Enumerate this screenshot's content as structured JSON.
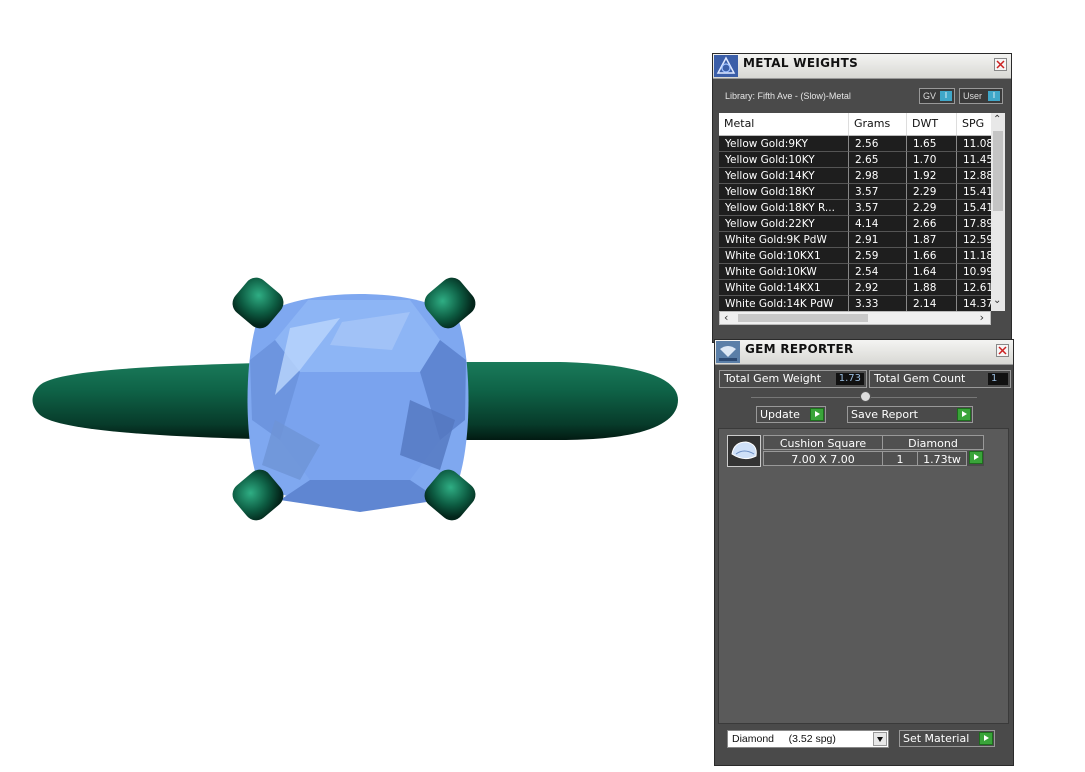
{
  "metal_weights": {
    "title": "METAL WEIGHTS",
    "library": "Library: Fifth Ave - (Slow)-Metal",
    "toggle_gv": "GV",
    "toggle_user": "User",
    "toggle_indicator": "I",
    "columns": [
      "Metal",
      "Grams",
      "DWT",
      "SPG"
    ],
    "rows": [
      [
        "Yellow Gold:9KY",
        "2.56",
        "1.65",
        "11.08"
      ],
      [
        "Yellow Gold:10KY",
        "2.65",
        "1.70",
        "11.45"
      ],
      [
        "Yellow Gold:14KY",
        "2.98",
        "1.92",
        "12.88"
      ],
      [
        "Yellow Gold:18KY",
        "3.57",
        "2.29",
        "15.41"
      ],
      [
        "Yellow Gold:18KY R...",
        "3.57",
        "2.29",
        "15.41"
      ],
      [
        "Yellow Gold:22KY",
        "4.14",
        "2.66",
        "17.89"
      ],
      [
        "White Gold:9K PdW",
        "2.91",
        "1.87",
        "12.59"
      ],
      [
        "White Gold:10KX1",
        "2.59",
        "1.66",
        "11.18"
      ],
      [
        "White Gold:10KW",
        "2.54",
        "1.64",
        "10.99"
      ],
      [
        "White Gold:14KX1",
        "2.92",
        "1.88",
        "12.61"
      ],
      [
        "White Gold:14K PdW",
        "3.33",
        "2.14",
        "14.37"
      ]
    ]
  },
  "gem_reporter": {
    "title": "GEM REPORTER",
    "total_weight_label": "Total Gem Weight",
    "total_weight_value": "1.73",
    "total_count_label": "Total Gem Count",
    "total_count_value": "1",
    "update_label": "Update",
    "save_report_label": "Save Report",
    "gem": {
      "shape": "Cushion Square",
      "material": "Diamond",
      "size": "7.00 X 7.00",
      "count": "1",
      "weight": "1.73tw"
    },
    "material_select": "Diamond     (3.52 spg)",
    "set_material_label": "Set Material"
  },
  "colors": {
    "panel_bg": "#4a4a4a",
    "table_bg": "#1e1e1e",
    "gem_blue": "#7fa8f0",
    "metal_green": "#0f6448",
    "go_green": "#3aa43a"
  }
}
